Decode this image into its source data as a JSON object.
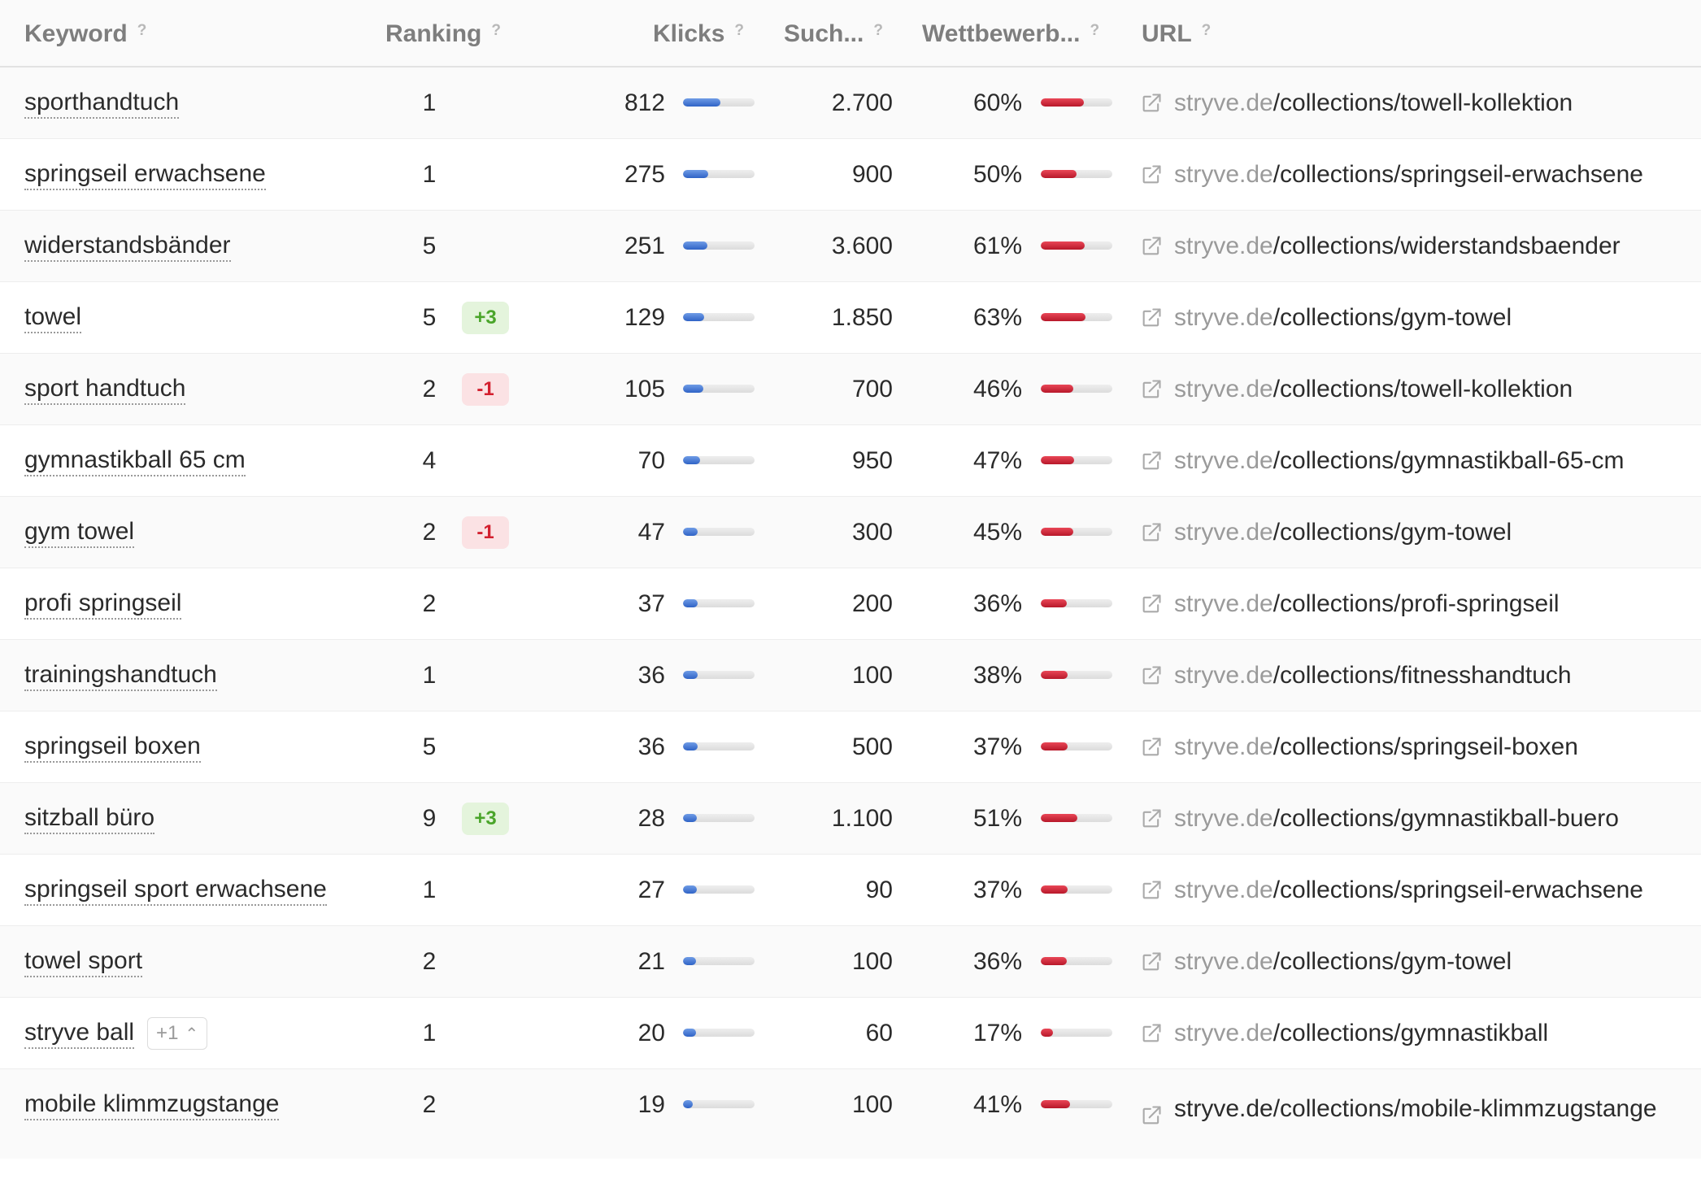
{
  "headers": {
    "keyword": "Keyword",
    "ranking": "Ranking",
    "klicks": "Klicks",
    "such": "Such...",
    "wett": "Wettbewerb...",
    "url": "URL",
    "help": "?"
  },
  "rows": [
    {
      "keyword": "sporthandtuch",
      "rank": "1",
      "change": "",
      "klicks": "812",
      "klicks_fraction": 0.52,
      "such": "2.700",
      "wett": "60%",
      "wett_fraction": 0.6,
      "domain": "stryve.de",
      "path": "/collections/towell-kollektion"
    },
    {
      "keyword": "springseil erwachsene",
      "rank": "1",
      "change": "",
      "klicks": "275",
      "klicks_fraction": 0.35,
      "such": "900",
      "wett": "50%",
      "wett_fraction": 0.5,
      "domain": "stryve.de",
      "path": "/collections/springseil-erwachsene"
    },
    {
      "keyword": "widerstandsbänder",
      "rank": "5",
      "change": "",
      "klicks": "251",
      "klicks_fraction": 0.34,
      "such": "3.600",
      "wett": "61%",
      "wett_fraction": 0.61,
      "domain": "stryve.de",
      "path": "/collections/widerstandsbaender"
    },
    {
      "keyword": "towel",
      "rank": "5",
      "change": "+3",
      "klicks": "129",
      "klicks_fraction": 0.29,
      "such": "1.850",
      "wett": "63%",
      "wett_fraction": 0.63,
      "domain": "stryve.de",
      "path": "/collections/gym-towel"
    },
    {
      "keyword": "sport handtuch",
      "rank": "2",
      "change": "-1",
      "klicks": "105",
      "klicks_fraction": 0.28,
      "such": "700",
      "wett": "46%",
      "wett_fraction": 0.46,
      "domain": "stryve.de",
      "path": "/collections/towell-kollektion"
    },
    {
      "keyword": "gymnastikball 65 cm",
      "rank": "4",
      "change": "",
      "klicks": "70",
      "klicks_fraction": 0.24,
      "such": "950",
      "wett": "47%",
      "wett_fraction": 0.47,
      "domain": "stryve.de",
      "path": "/collections/gymnastikball-65-cm"
    },
    {
      "keyword": "gym towel",
      "rank": "2",
      "change": "-1",
      "klicks": "47",
      "klicks_fraction": 0.21,
      "such": "300",
      "wett": "45%",
      "wett_fraction": 0.45,
      "domain": "stryve.de",
      "path": "/collections/gym-towel"
    },
    {
      "keyword": "profi springseil",
      "rank": "2",
      "change": "",
      "klicks": "37",
      "klicks_fraction": 0.2,
      "such": "200",
      "wett": "36%",
      "wett_fraction": 0.36,
      "domain": "stryve.de",
      "path": "/collections/profi-springseil"
    },
    {
      "keyword": "trainingshandtuch",
      "rank": "1",
      "change": "",
      "klicks": "36",
      "klicks_fraction": 0.2,
      "such": "100",
      "wett": "38%",
      "wett_fraction": 0.38,
      "domain": "stryve.de",
      "path": "/collections/fitnesshandtuch"
    },
    {
      "keyword": "springseil boxen",
      "rank": "5",
      "change": "",
      "klicks": "36",
      "klicks_fraction": 0.2,
      "such": "500",
      "wett": "37%",
      "wett_fraction": 0.37,
      "domain": "stryve.de",
      "path": "/collections/springseil-boxen"
    },
    {
      "keyword": "sitzball büro",
      "rank": "9",
      "change": "+3",
      "klicks": "28",
      "klicks_fraction": 0.19,
      "such": "1.100",
      "wett": "51%",
      "wett_fraction": 0.51,
      "domain": "stryve.de",
      "path": "/collections/gymnastikball-buero"
    },
    {
      "keyword": "springseil sport erwachsene",
      "rank": "1",
      "change": "",
      "klicks": "27",
      "klicks_fraction": 0.19,
      "such": "90",
      "wett": "37%",
      "wett_fraction": 0.37,
      "domain": "stryve.de",
      "path": "/collections/springseil-erwachsene"
    },
    {
      "keyword": "towel sport",
      "rank": "2",
      "change": "",
      "klicks": "21",
      "klicks_fraction": 0.18,
      "such": "100",
      "wett": "36%",
      "wett_fraction": 0.36,
      "domain": "stryve.de",
      "path": "/collections/gym-towel"
    },
    {
      "keyword": "stryve ball",
      "rank": "1",
      "change": "",
      "more": "+1",
      "klicks": "20",
      "klicks_fraction": 0.18,
      "such": "60",
      "wett": "17%",
      "wett_fraction": 0.17,
      "domain": "stryve.de",
      "path": "/collections/gymnastikball"
    },
    {
      "keyword": "mobile klimmzugstange",
      "rank": "2",
      "change": "",
      "klicks": "19",
      "klicks_fraction": 0.14,
      "such": "100",
      "wett": "41%",
      "wett_fraction": 0.41,
      "domain": "stryve.de",
      "path": "/collections/mobile-klimmzugstange"
    }
  ]
}
